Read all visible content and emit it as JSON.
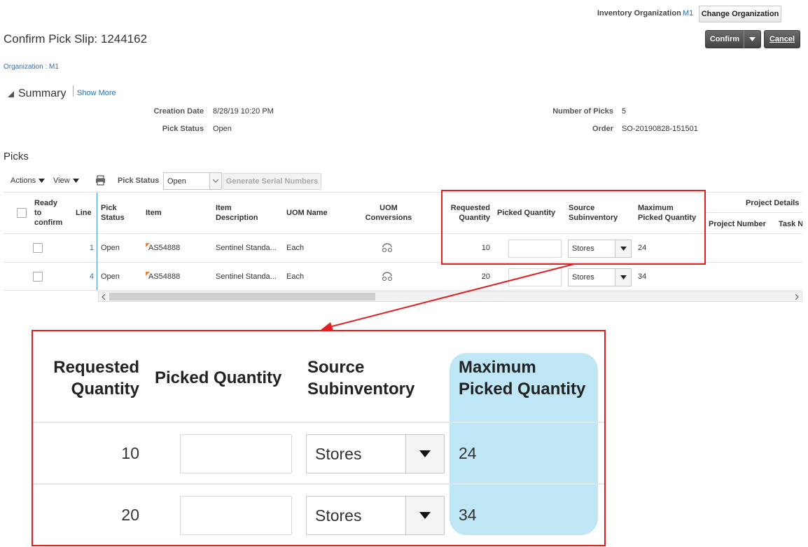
{
  "header": {
    "inventory_org_label": "Inventory Organization",
    "inventory_org_value": "M1",
    "change_org_label": "Change Organization",
    "confirm_label": "Confirm",
    "cancel_label": "Cancel"
  },
  "page": {
    "title": "Confirm Pick Slip: 1244162",
    "organization_link": "Organization : M1"
  },
  "summary": {
    "title": "Summary",
    "show_more": "Show More",
    "creation_date_label": "Creation Date",
    "creation_date_value": "8/28/19 10:20 PM",
    "pick_status_label": "Pick Status",
    "pick_status_value": "Open",
    "number_of_picks_label": "Number of Picks",
    "number_of_picks_value": "5",
    "order_label": "Order",
    "order_value": "SO-20190828-151501"
  },
  "picks": {
    "title": "Picks",
    "toolbar": {
      "actions": "Actions",
      "view": "View",
      "pick_status_label": "Pick Status",
      "pick_status_value": "Open",
      "generate_serial": "Generate Serial Numbers"
    },
    "columns": {
      "ready": [
        "Ready",
        "to",
        "confirm"
      ],
      "line": "Line",
      "pick_status": [
        "Pick",
        "Status"
      ],
      "item": "Item",
      "item_description": [
        "Item",
        "Description"
      ],
      "uom_name": "UOM Name",
      "uom_conversions": [
        "UOM",
        "Conversions"
      ],
      "requested_quantity": [
        "Requested",
        "Quantity"
      ],
      "picked_quantity": "Picked Quantity",
      "source_subinventory": [
        "Source",
        "Subinventory"
      ],
      "maximum_picked_quantity": [
        "Maximum",
        "Picked Quantity"
      ],
      "project_details": "Project Details",
      "project_number": "Project Number",
      "task_number": "Task N"
    },
    "rows": [
      {
        "line": "1",
        "status": "Open",
        "item": "AS54888",
        "description": "Sentinel Standa...",
        "uom": "Each",
        "requested": "10",
        "subinventory": "Stores",
        "max_picked": "24"
      },
      {
        "line": "4",
        "status": "Open",
        "item": "AS54888",
        "description": "Sentinel Standa...",
        "uom": "Each",
        "requested": "20",
        "subinventory": "Stores",
        "max_picked": "34"
      }
    ]
  },
  "zoom": {
    "requested_quantity": [
      "Requested",
      "Quantity"
    ],
    "picked_quantity": "Picked Quantity",
    "source_subinventory": [
      "Source",
      "Subinventory"
    ],
    "maximum_picked_quantity": [
      "Maximum",
      "Picked Quantity"
    ],
    "rows": [
      {
        "requested": "10",
        "subinventory": "Stores",
        "max_picked": "24"
      },
      {
        "requested": "20",
        "subinventory": "Stores",
        "max_picked": "34"
      }
    ],
    "highlight_color": "#bfe6f5",
    "callout_color": "#e02020"
  }
}
